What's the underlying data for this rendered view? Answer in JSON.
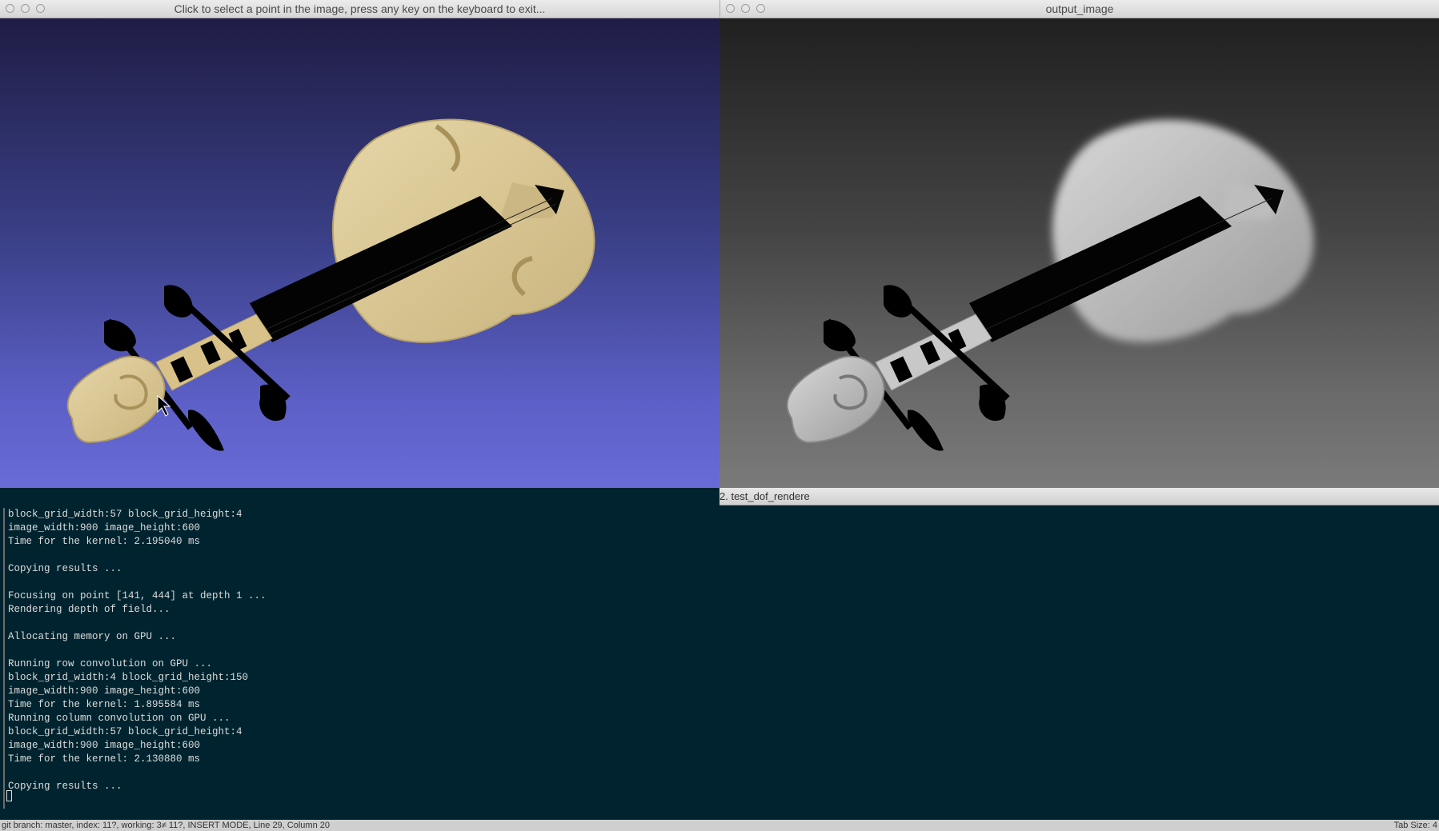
{
  "left_window": {
    "title": "Click to select a point in the image, press any key on the keyboard to exit..."
  },
  "right_window": {
    "title": "output_image"
  },
  "terminal": {
    "tab_title": "2. test_dof_rendere",
    "lines": [
      "block_grid_width:57 block_grid_height:4",
      "image_width:900 image_height:600",
      "Time for the kernel: 2.195040 ms",
      "",
      "Copying results ...",
      "",
      "Focusing on point [141, 444] at depth 1 ...",
      "Rendering depth of field...",
      "",
      "Allocating memory on GPU ...",
      "",
      "Running row convolution on GPU ...",
      "block_grid_width:4 block_grid_height:150",
      "image_width:900 image_height:600",
      "Time for the kernel: 1.895584 ms",
      "Running column convolution on GPU ...",
      "block_grid_width:57 block_grid_height:4",
      "image_width:900 image_height:600",
      "Time for the kernel: 2.130880 ms",
      "",
      "Copying results ..."
    ]
  },
  "status_bar": {
    "left": "git branch: master, index: 11?, working: 3≠ 11?, INSERT MODE, Line 29, Column 20",
    "right": "Tab Size: 4"
  },
  "colors": {
    "violin_body": "#d9c48f",
    "viewport_top": "#1f1d45",
    "viewport_bottom": "#6a6cd8",
    "terminal_bg": "#00242f"
  }
}
